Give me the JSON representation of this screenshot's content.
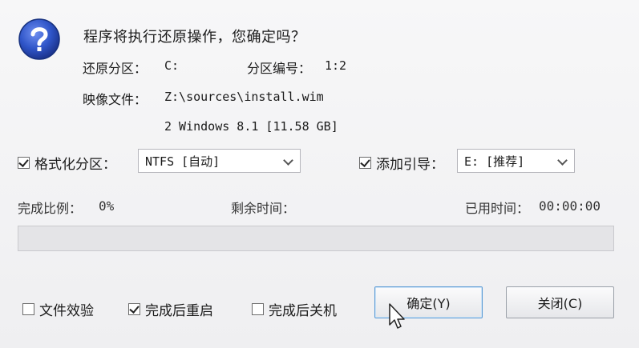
{
  "dialog": {
    "message": "程序将执行还原操作，您确定吗？",
    "restore_partition_label": "还原分区：",
    "restore_partition_value": "C:",
    "partition_number_label": "分区编号：",
    "partition_number_value": "1:2",
    "image_file_label": "映像文件：",
    "image_file_value": "Z:\\sources\\install.wim",
    "image_index_value": "2 Windows 8.1 [11.58 GB]"
  },
  "options": {
    "format_label": "格式化分区：",
    "format_checked": true,
    "format_value": "NTFS [自动]",
    "boot_label": "添加引导：",
    "boot_checked": true,
    "boot_value": "E: [推荐]"
  },
  "progress": {
    "percent_label": "完成比例：",
    "percent_value": "0%",
    "remaining_label": "剩余时间：",
    "remaining_value": "",
    "elapsed_label": "已用时间：",
    "elapsed_value": "00:00:00",
    "fraction": 0
  },
  "footer": {
    "verify_label": "文件效验",
    "verify_checked": false,
    "restart_label": "完成后重启",
    "restart_checked": true,
    "shutdown_label": "完成后关机",
    "shutdown_checked": false,
    "ok_label": "确定(Y)",
    "close_label": "关闭(C)"
  },
  "icons": {
    "dialog_icon": "question-icon",
    "cursor": "mouse-pointer-icon"
  },
  "colors": {
    "icon_blue": "#2f55c8",
    "button_focus": "#5b9bd5"
  }
}
